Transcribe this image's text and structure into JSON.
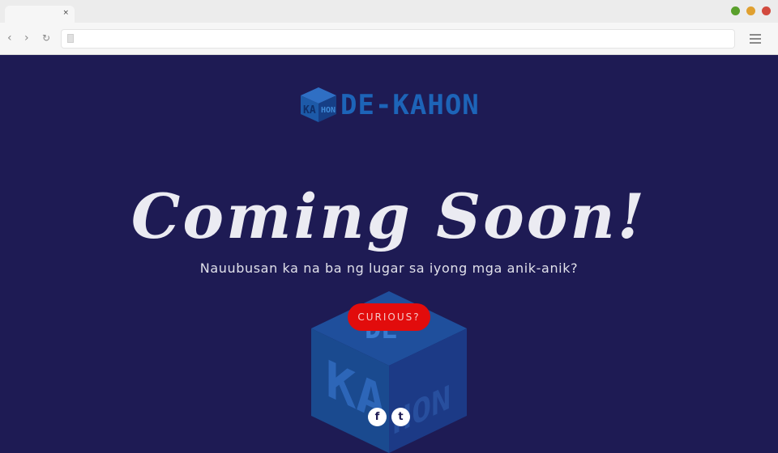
{
  "browser": {
    "tab": {
      "close": "×"
    },
    "window_dots": [
      {
        "name": "window-maximize-dot",
        "color": "#5aa02c"
      },
      {
        "name": "window-minimize-dot",
        "color": "#e0a030"
      },
      {
        "name": "window-close-dot",
        "color": "#d24a3e"
      }
    ],
    "nav": {
      "back_icon": "‹",
      "forward_icon": "›",
      "reload_icon": "↻"
    },
    "address": {
      "value": ""
    },
    "menu_icon": "hamburger-icon"
  },
  "page": {
    "brand": {
      "logo_text": "DE-KAHON",
      "icon": "cube-logo-icon",
      "color": "#1d64b8"
    },
    "headline": "Coming Soon!",
    "tagline": "Nauubusan ka na ba ng lugar sa iyong mga anik-anik?",
    "cta_label": "CURIOUS?",
    "cta_color": "#e20c0c",
    "background_color": "#1e1b54",
    "social": [
      {
        "name": "facebook-icon",
        "glyph": "f"
      },
      {
        "name": "twitter-icon",
        "glyph": "t"
      }
    ]
  }
}
